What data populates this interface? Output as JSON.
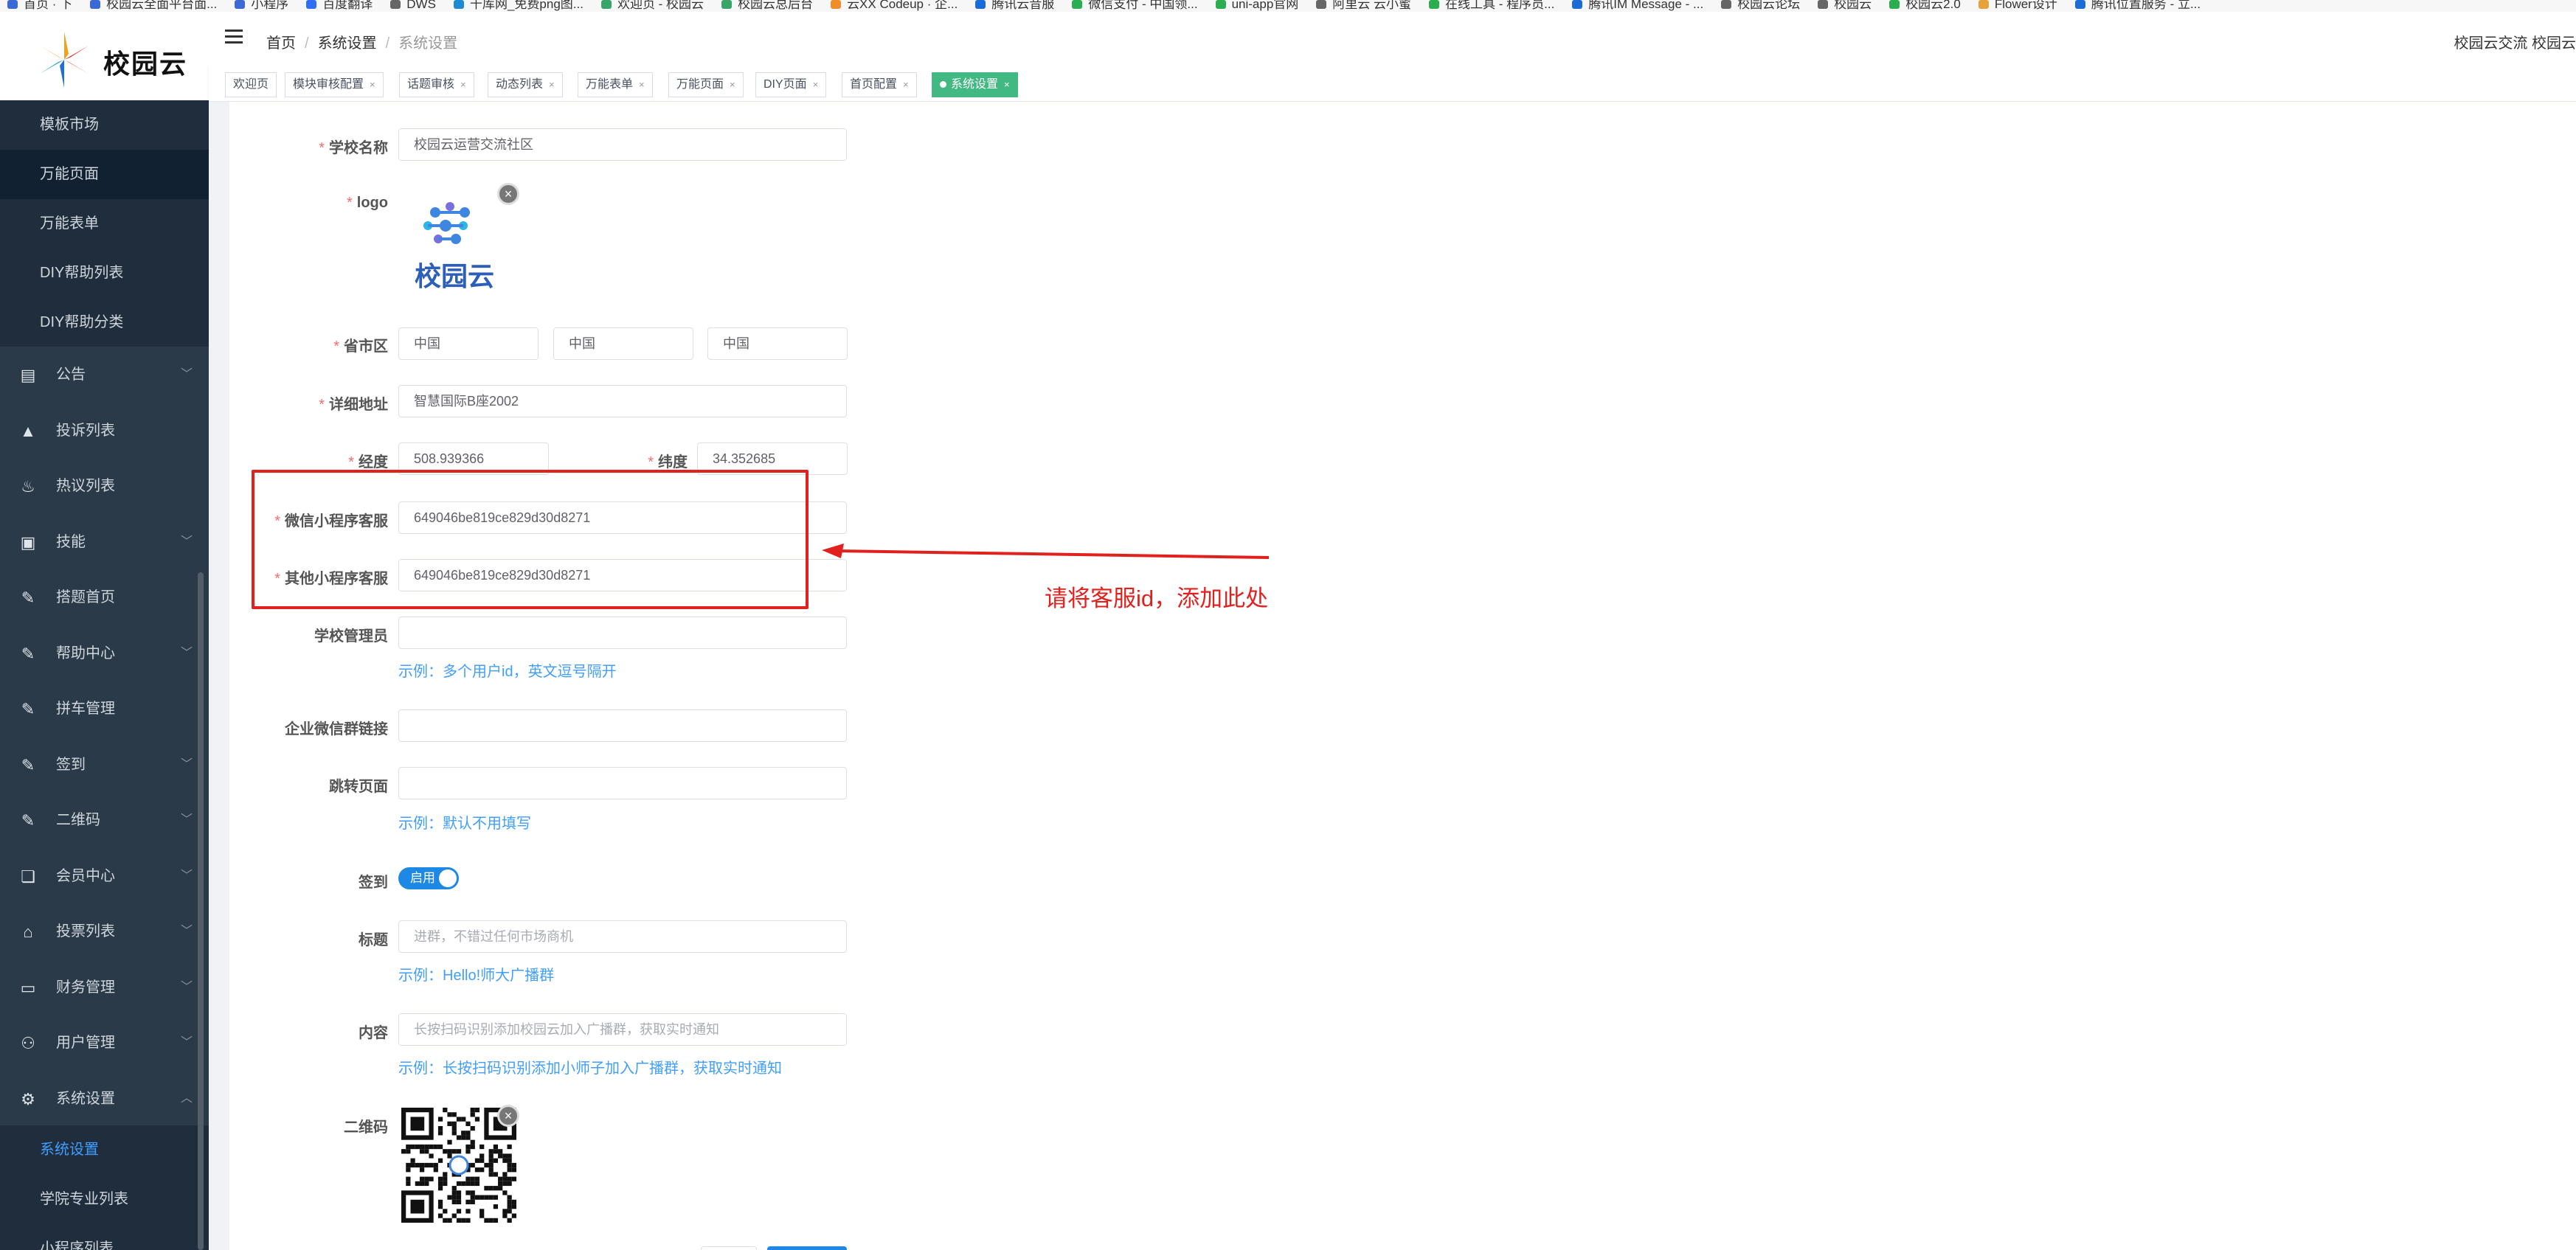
{
  "bookmarks": [
    {
      "label": "首页 · 下",
      "color": "#3b6ad6"
    },
    {
      "label": "校园云全面平台面...",
      "color": "#3b6ad6"
    },
    {
      "label": "小程序",
      "color": "#3b6ad6"
    },
    {
      "label": "百度翻译",
      "color": "#2f6ff5"
    },
    {
      "label": "DWS",
      "color": "#666666"
    },
    {
      "label": "千库网_免费png图...",
      "color": "#1f8ad4"
    },
    {
      "label": "欢迎页 - 校园云",
      "color": "#3aa568"
    },
    {
      "label": "校园云总后台",
      "color": "#3aa568"
    },
    {
      "label": "云XX Codeup · 企...",
      "color": "#f08c2a"
    },
    {
      "label": "腾讯云音服",
      "color": "#1b6cd6"
    },
    {
      "label": "微信支付 - 中国领...",
      "color": "#2aae4f"
    },
    {
      "label": "uni-app官网",
      "color": "#2aae4f"
    },
    {
      "label": "阿里云 云小蜜",
      "color": "#666666"
    },
    {
      "label": "在线工具 - 程序员...",
      "color": "#2aae4f"
    },
    {
      "label": "腾讯IM Message - ...",
      "color": "#1b6cd6"
    },
    {
      "label": "校园云论坛",
      "color": "#666666"
    },
    {
      "label": "校园云",
      "color": "#666666"
    },
    {
      "label": "校园云2.0",
      "color": "#2aae4f"
    },
    {
      "label": "Flower设计",
      "color": "#e7a23c"
    },
    {
      "label": "腾讯位置服务 - 立...",
      "color": "#1b6cd6"
    }
  ],
  "app": {
    "logo_text": "校园云",
    "user": "校园云交流 校园云"
  },
  "sidebar": {
    "sub_items_top": [
      {
        "label": "模板市场"
      },
      {
        "label": "万能页面"
      },
      {
        "label": "万能表单"
      },
      {
        "label": "DIY帮助列表"
      },
      {
        "label": "DIY帮助分类"
      }
    ],
    "menu": [
      {
        "label": "公告",
        "icon": "shop-icon",
        "glyph": "▤",
        "expand": true
      },
      {
        "label": "投诉列表",
        "icon": "warning-icon",
        "glyph": "▲",
        "expand": false
      },
      {
        "label": "热议列表",
        "icon": "flame-icon",
        "glyph": "♨",
        "expand": false
      },
      {
        "label": "技能",
        "icon": "skill-icon",
        "glyph": "▣",
        "expand": true
      },
      {
        "label": "搭题首页",
        "icon": "edit-icon",
        "glyph": "✎",
        "expand": false
      },
      {
        "label": "帮助中心",
        "icon": "edit-icon",
        "glyph": "✎",
        "expand": true
      },
      {
        "label": "拼车管理",
        "icon": "edit-icon",
        "glyph": "✎",
        "expand": false
      },
      {
        "label": "签到",
        "icon": "edit-icon",
        "glyph": "✎",
        "expand": true
      },
      {
        "label": "二维码",
        "icon": "edit-icon",
        "glyph": "✎",
        "expand": true
      },
      {
        "label": "会员中心",
        "icon": "book-icon",
        "glyph": "❏",
        "expand": true
      },
      {
        "label": "投票列表",
        "icon": "gift-icon",
        "glyph": "⌂",
        "expand": true
      },
      {
        "label": "财务管理",
        "icon": "wallet-icon",
        "glyph": "▭",
        "expand": true
      },
      {
        "label": "用户管理",
        "icon": "user-gear-icon",
        "glyph": "⚇",
        "expand": true
      },
      {
        "label": "系统设置",
        "icon": "gear-icon",
        "glyph": "⚙",
        "expand": true
      }
    ],
    "sub_items_bottom": [
      {
        "label": "系统设置"
      },
      {
        "label": "学院专业列表"
      },
      {
        "label": "小程序列表"
      }
    ]
  },
  "breadcrumb": [
    "首页",
    "系统设置",
    "系统设置"
  ],
  "tabs": [
    {
      "label": "欢迎页"
    },
    {
      "label": "模块审核配置"
    },
    {
      "label": "话题审核"
    },
    {
      "label": "动态列表"
    },
    {
      "label": "万能表单"
    },
    {
      "label": "万能页面"
    },
    {
      "label": "DIY页面"
    },
    {
      "label": "首页配置"
    },
    {
      "label": "系统设置"
    }
  ],
  "form": {
    "school_name": {
      "label": "学校名称",
      "value": "校园云运营交流社区"
    },
    "logo": {
      "label": "logo",
      "image_text": "校园云"
    },
    "region": {
      "label": "省市区",
      "province": "中国",
      "city": "中国",
      "district": "中国"
    },
    "address": {
      "label": "详细地址",
      "value": "智慧国际B座2002"
    },
    "longitude": {
      "label": "经度",
      "value": "508.939366"
    },
    "latitude": {
      "label": "纬度",
      "value": "34.352685"
    },
    "wechat_service": {
      "label": "微信小程序客服",
      "value": "649046be819ce829d30d8271"
    },
    "other_service": {
      "label": "其他小程序客服",
      "value": "649046be819ce829d30d8271"
    },
    "admins": {
      "label": "学校管理员",
      "value": "",
      "hint": "示例：多个用户id，英文逗号隔开"
    },
    "wecom_link": {
      "label": "企业微信群链接",
      "value": ""
    },
    "jump_page": {
      "label": "跳转页面",
      "value": "",
      "hint": "示例：默认不用填写"
    },
    "checkin": {
      "label": "签到",
      "switch_text": "启用",
      "enabled": true
    },
    "title": {
      "label": "标题",
      "placeholder": "进群，不错过任何市场商机",
      "hint": "示例：Hello!师大广播群"
    },
    "content": {
      "label": "内容",
      "placeholder": "长按扫码识别添加校园云加入广播群，获取实时通知",
      "hint": "示例：长按扫码识别添加小师子加入广播群，获取实时通知"
    },
    "qrcode": {
      "label": "二维码"
    }
  },
  "annotation": {
    "text": "请将客服id，添加此处",
    "color": "#e0211d"
  },
  "colors": {
    "sidebar_bg": "#2b3a49",
    "sidebar_sub_bg": "#1f2d3d",
    "active_tab": "#42b983",
    "link_blue": "#409eff",
    "required_red": "#f56c6c"
  }
}
